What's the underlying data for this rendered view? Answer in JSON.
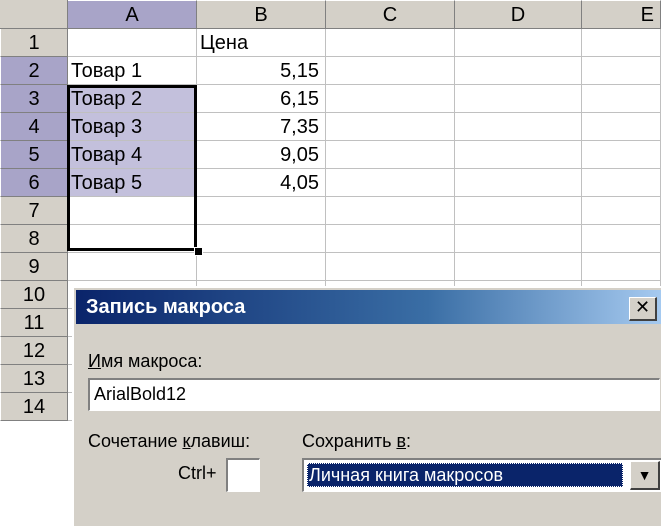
{
  "sheet": {
    "columns": [
      "A",
      "B",
      "C",
      "D",
      "E"
    ],
    "rows": [
      "1",
      "2",
      "3",
      "4",
      "5",
      "6",
      "7",
      "8",
      "9",
      "10",
      "11",
      "12",
      "13",
      "14"
    ],
    "b1": "Цена",
    "products": [
      "Товар 1",
      "Товар 2",
      "Товар 3",
      "Товар 4",
      "Товар 5"
    ],
    "prices": [
      "5,15",
      "6,15",
      "7,35",
      "9,05",
      "4,05"
    ]
  },
  "dialog": {
    "title": "Запись макроса",
    "close_icon": "close-icon",
    "macro_name_label_accel": "И",
    "macro_name_label_rest": "мя макроса:",
    "macro_name_value": "ArialBold12",
    "shortcut_label_pre": "Сочетание ",
    "shortcut_label_accel": "к",
    "shortcut_label_post": "лавиш:",
    "ctrl_label": "Ctrl+",
    "shortcut_value": "",
    "save_in_label_pre": "Сохранить ",
    "save_in_label_accel": "в",
    "save_in_label_post": ":",
    "save_in_value": "Личная книга макросов",
    "dropdown_icon": "chevron-down-icon"
  },
  "colors": {
    "header_bg": "#d4d0c8",
    "selected_header_bg": "#a8a4c8",
    "selected_cell_bg": "#c3c0dc",
    "title_bar": "#0a246a"
  }
}
